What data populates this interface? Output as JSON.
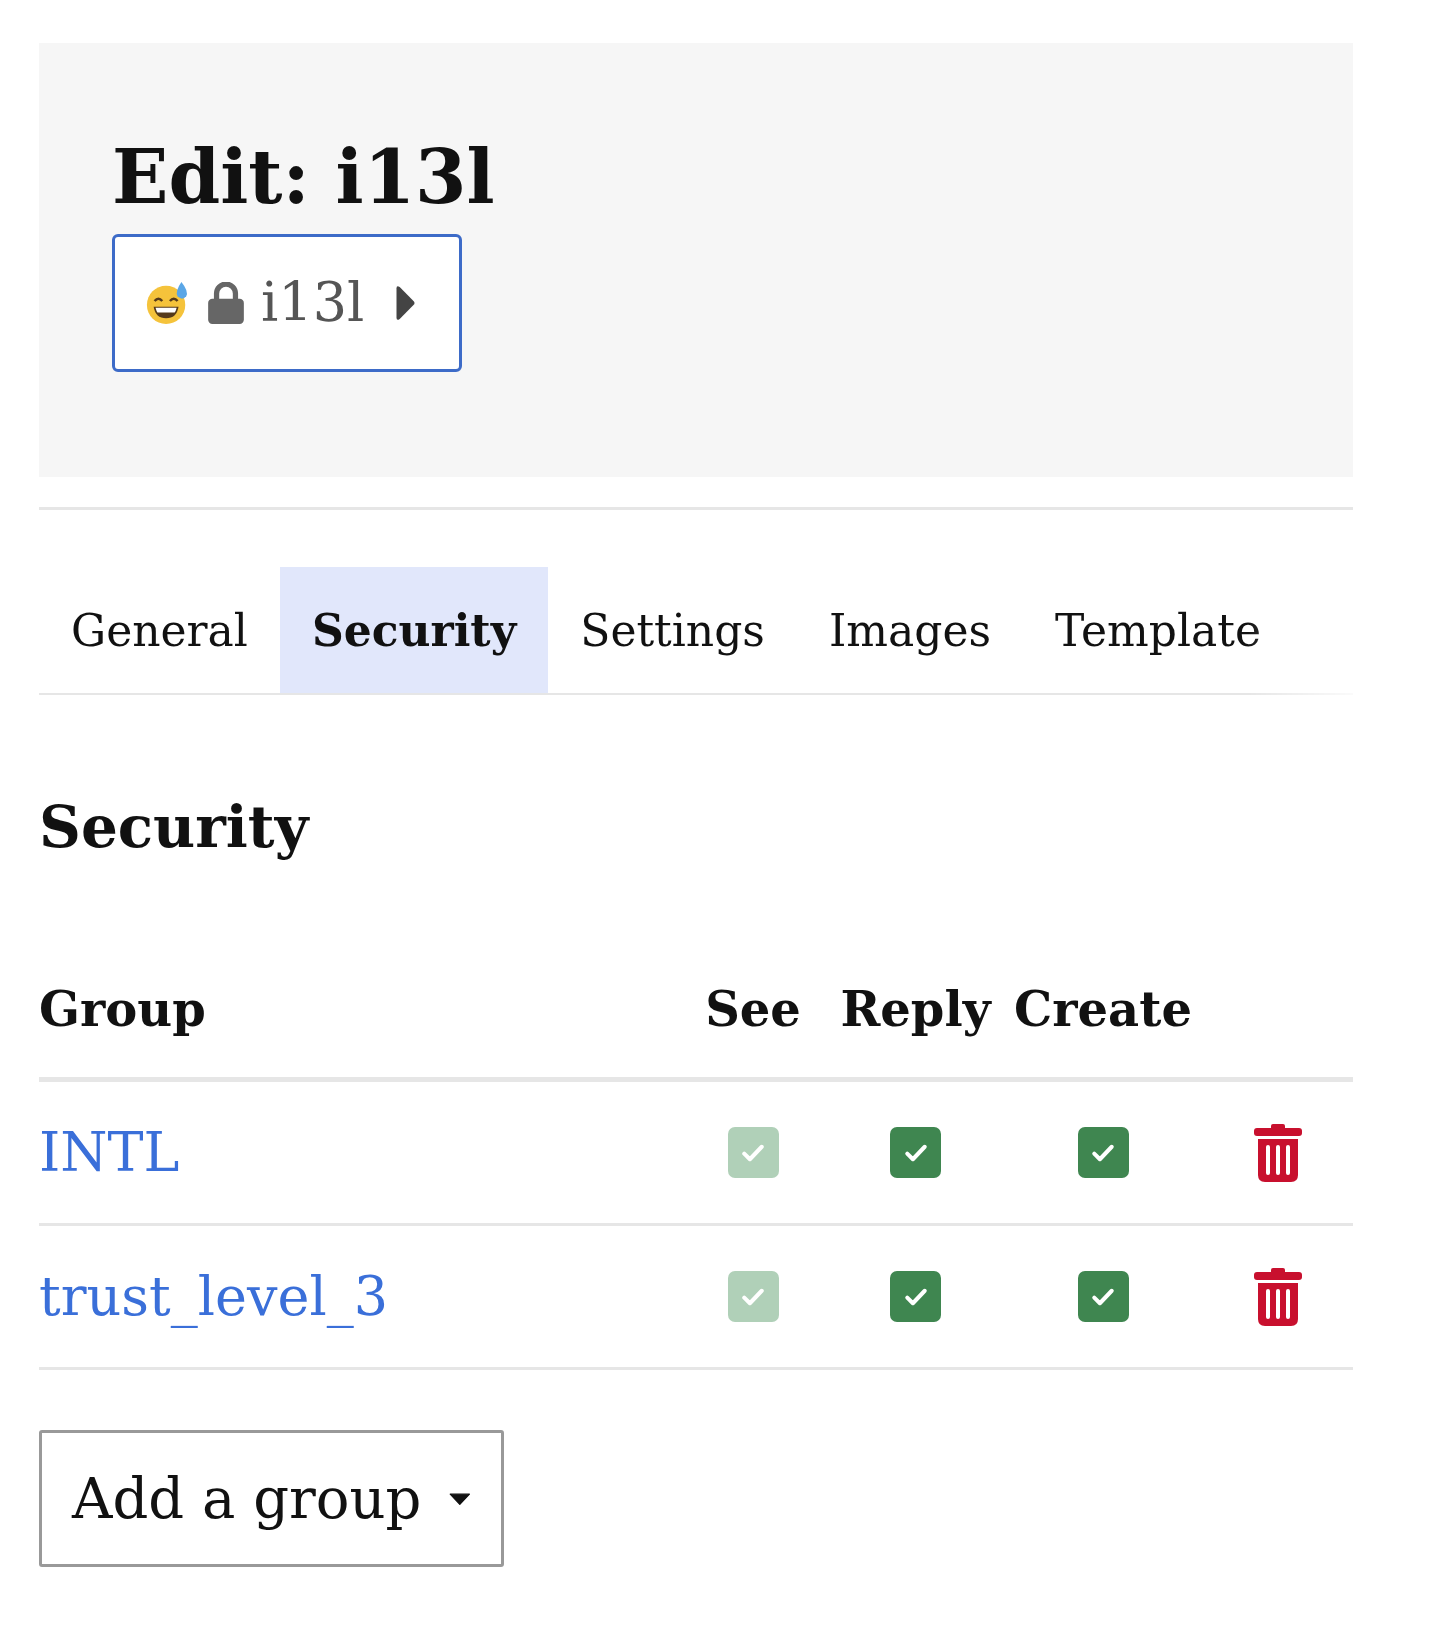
{
  "header": {
    "title": "Edit: i13l",
    "category_badge": {
      "name": "i13l"
    }
  },
  "tabs": [
    {
      "label": "General",
      "selected": false
    },
    {
      "label": "Security",
      "selected": true
    },
    {
      "label": "Settings",
      "selected": false
    },
    {
      "label": "Images",
      "selected": false
    },
    {
      "label": "Template",
      "selected": false
    }
  ],
  "section_title": "Security",
  "table": {
    "columns": [
      "Group",
      "See",
      "Reply",
      "Create"
    ],
    "rows": [
      {
        "group": "INTL",
        "permissions": [
          {
            "checked": true,
            "disabled": true
          },
          {
            "checked": true,
            "disabled": false
          },
          {
            "checked": true,
            "disabled": false
          }
        ]
      },
      {
        "group": "trust_level_3",
        "permissions": [
          {
            "checked": true,
            "disabled": true
          },
          {
            "checked": true,
            "disabled": false
          },
          {
            "checked": true,
            "disabled": false
          }
        ]
      }
    ]
  },
  "add_group": {
    "label": "Add a group"
  }
}
